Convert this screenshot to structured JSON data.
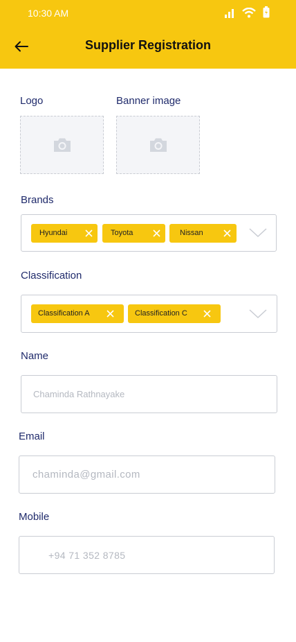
{
  "status_bar": {
    "time": "10:30 AM"
  },
  "header": {
    "title": "Supplier Registration"
  },
  "logo": {
    "label": "Logo"
  },
  "banner": {
    "label": "Banner image"
  },
  "brands": {
    "label": "Brands",
    "chips": [
      "Hyundai",
      "Toyota",
      "Nissan"
    ]
  },
  "classification": {
    "label": "Classification",
    "chips": [
      "Classification A",
      "Classification C"
    ]
  },
  "name": {
    "label": "Name",
    "placeholder": "Chaminda Rathnayake"
  },
  "email": {
    "label": "Email",
    "placeholder": "chaminda@gmail.com"
  },
  "mobile": {
    "label": "Mobile",
    "placeholder": "+94 71 352 8785"
  },
  "colors": {
    "accent": "#f7c710",
    "label": "#1f2a6b",
    "border": "#c9ccd3"
  }
}
